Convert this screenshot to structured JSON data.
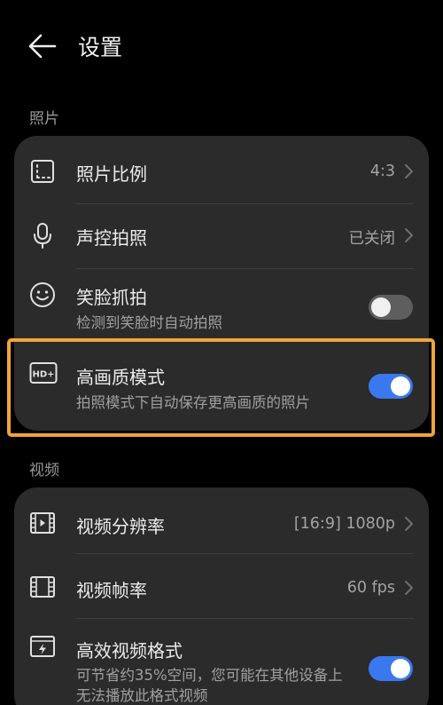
{
  "header": {
    "title": "设置"
  },
  "sections": {
    "photo": {
      "label": "照片",
      "items": [
        {
          "label": "照片比例",
          "value": "4:3"
        },
        {
          "label": "声控拍照",
          "value": "已关闭"
        },
        {
          "label": "笑脸抓拍",
          "subtitle": "检测到笑脸时自动拍照",
          "toggle": false
        },
        {
          "label": "高画质模式",
          "subtitle": "拍照模式下自动保存更高画质的照片",
          "toggle": true
        }
      ]
    },
    "video": {
      "label": "视频",
      "items": [
        {
          "label": "视频分辨率",
          "value": "[16:9] 1080p"
        },
        {
          "label": "视频帧率",
          "value": "60 fps"
        },
        {
          "label": "高效视频格式",
          "subtitle": "可节省约35%空间，您可能在其他设备上无法播放此格式视频",
          "toggle": true
        }
      ]
    }
  },
  "icons": {
    "back": "back-arrow-icon",
    "hd": "HD+"
  },
  "colors": {
    "background": "#000000",
    "card": "#2b2b2b",
    "toggle_on": "#3a78f0",
    "toggle_off": "#5e5e5e",
    "highlight": "#f1a43a"
  }
}
